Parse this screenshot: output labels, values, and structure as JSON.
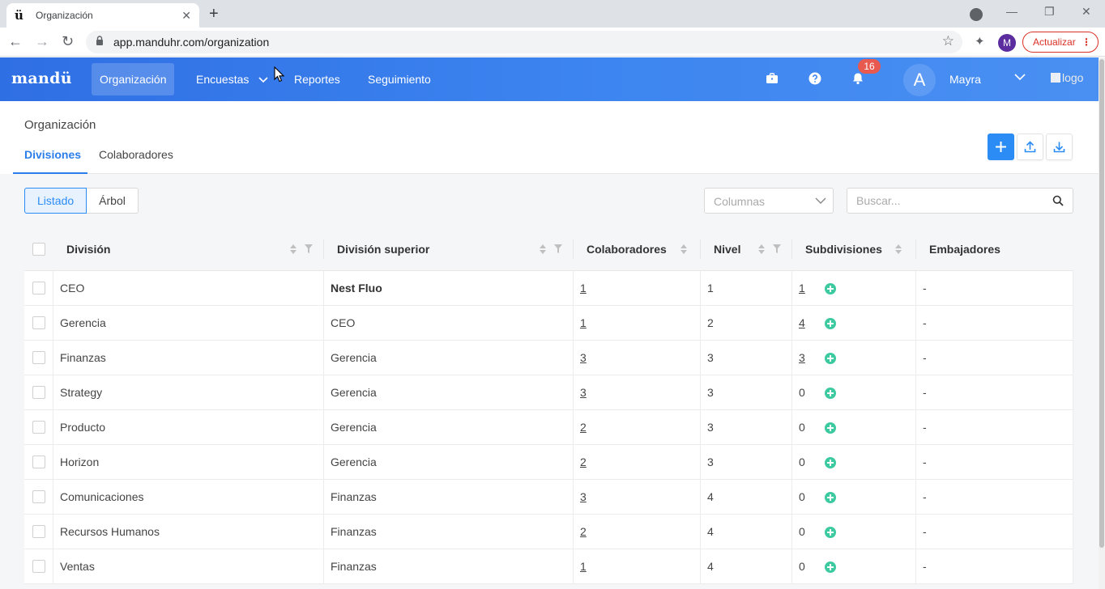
{
  "browser": {
    "tab_title": "Organización",
    "favicon": "ü",
    "url": "app.manduhr.com/organization",
    "profile_initial": "M",
    "update_label": "Actualizar"
  },
  "app": {
    "logo": "mandü",
    "menu": [
      {
        "label": "Organización",
        "active": true
      },
      {
        "label": "Encuestas",
        "dropdown": true
      },
      {
        "label": "Reportes"
      },
      {
        "label": "Seguimiento"
      }
    ],
    "notifications_count": "16",
    "user_initial": "A",
    "user_name": "Mayra",
    "logo_alt": "logo"
  },
  "page": {
    "title": "Organización",
    "tabs": [
      "Divisiones",
      "Colaboradores"
    ],
    "view_toggle": [
      "Listado",
      "Árbol"
    ],
    "columns_placeholder": "Columnas",
    "search_placeholder": "Buscar..."
  },
  "table": {
    "headers": [
      "División",
      "División superior",
      "Colaboradores",
      "Nivel",
      "Subdivisiones",
      "Embajadores"
    ],
    "rows": [
      {
        "division": "CEO",
        "parent": "Nest Fluo",
        "parent_bold": true,
        "colaboradores": "1",
        "nivel": "1",
        "subdivisiones": "1",
        "sub_link": true,
        "embajadores": "-"
      },
      {
        "division": "Gerencia",
        "parent": "CEO",
        "colaboradores": "1",
        "nivel": "2",
        "subdivisiones": "4",
        "sub_link": true,
        "embajadores": "-"
      },
      {
        "division": "Finanzas",
        "parent": "Gerencia",
        "colaboradores": "3",
        "nivel": "3",
        "subdivisiones": "3",
        "sub_link": true,
        "embajadores": "-"
      },
      {
        "division": "Strategy",
        "parent": "Gerencia",
        "colaboradores": "3",
        "nivel": "3",
        "subdivisiones": "0",
        "embajadores": "-"
      },
      {
        "division": "Producto",
        "parent": "Gerencia",
        "colaboradores": "2",
        "nivel": "3",
        "subdivisiones": "0",
        "embajadores": "-"
      },
      {
        "division": "Horizon",
        "parent": "Gerencia",
        "colaboradores": "2",
        "nivel": "3",
        "subdivisiones": "0",
        "embajadores": "-"
      },
      {
        "division": "Comunicaciones",
        "parent": "Finanzas",
        "colaboradores": "3",
        "nivel": "4",
        "subdivisiones": "0",
        "embajadores": "-"
      },
      {
        "division": "Recursos Humanos",
        "parent": "Finanzas",
        "colaboradores": "2",
        "nivel": "4",
        "subdivisiones": "0",
        "embajadores": "-"
      },
      {
        "division": "Ventas",
        "parent": "Finanzas",
        "colaboradores": "1",
        "nivel": "4",
        "subdivisiones": "0",
        "embajadores": "-"
      }
    ]
  },
  "colors": {
    "header_start": "#2f6fe4",
    "header_end": "#4a90f2",
    "accent": "#2b8cf5",
    "add_dot": "#3dcaa0",
    "badge": "#e85a4f"
  }
}
